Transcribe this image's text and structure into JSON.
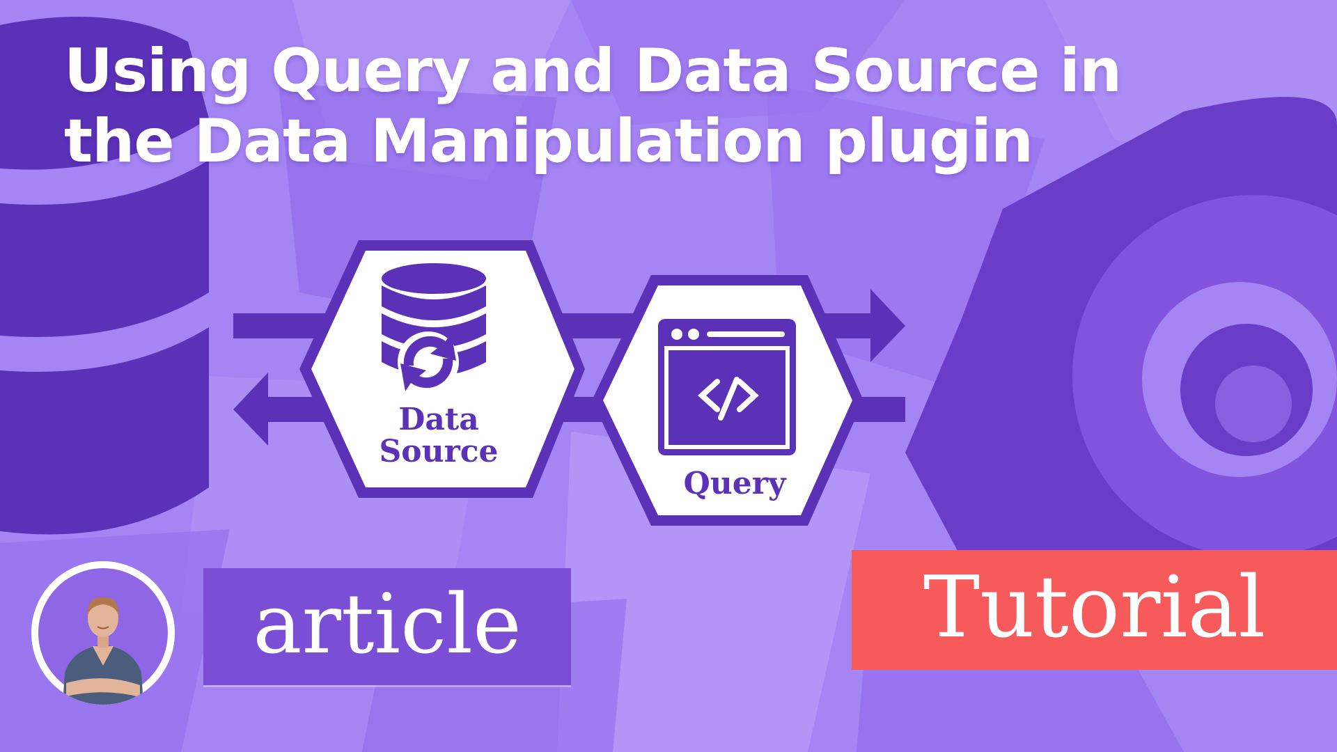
{
  "title": {
    "line1": "Using Query and Data Source in",
    "line2": "the Data Manipulation plugin"
  },
  "diagram": {
    "data_source": {
      "line1": "Data",
      "line2": "Source",
      "icon": "database-sync-icon"
    },
    "query": {
      "label": "Query",
      "icon": "code-window-icon"
    }
  },
  "badges": {
    "article": "article",
    "tutorial": "Tutorial"
  },
  "author": {
    "icon": "author-avatar"
  },
  "colors": {
    "background": "#a584f3",
    "deep_purple": "#5b31b8",
    "article_badge": "#7a4fd6",
    "tutorial_badge": "#f65a5a",
    "white": "#ffffff"
  }
}
